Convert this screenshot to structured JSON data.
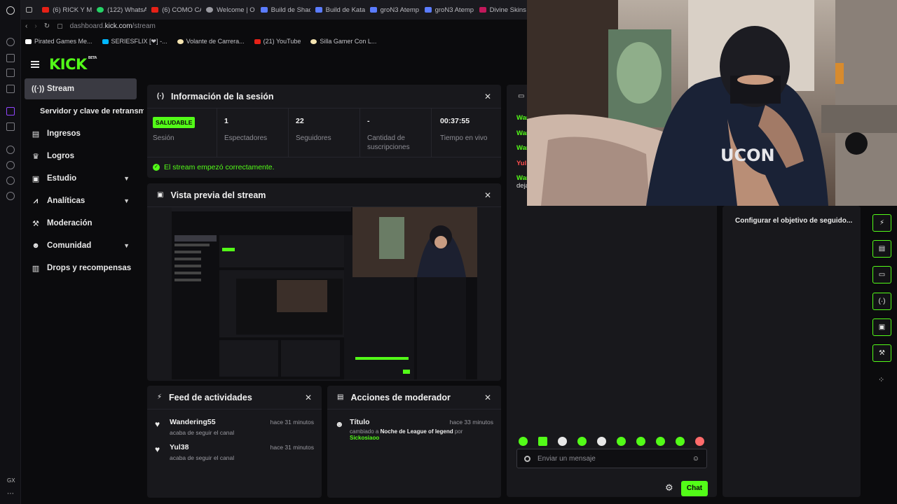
{
  "browser": {
    "tabs": [
      {
        "label": "(6) RICK Y M",
        "color": "#e62117"
      },
      {
        "label": "(122) WhatsA",
        "color": "#25d366"
      },
      {
        "label": "(6) COMO CA",
        "color": "#e62117"
      },
      {
        "label": "Welcome | O",
        "color": "#9a9aa1"
      },
      {
        "label": "Build de Shac",
        "color": "#5b7cff"
      },
      {
        "label": "Build de Kata",
        "color": "#5b7cff"
      },
      {
        "label": "groN3 Atemp",
        "color": "#5b7cff"
      },
      {
        "label": "groN3 Atemp",
        "color": "#5b7cff"
      },
      {
        "label": "Divine Skins",
        "color": "#c2185b"
      }
    ],
    "url_prefix": "dashboard.",
    "url_domain": "kick.com",
    "url_path": "/stream",
    "bookmarks": [
      {
        "label": "Pirated Games Me...",
        "color": "#ffffff"
      },
      {
        "label": "SERIESFLIX [❤] -...",
        "color": "#00b7ff"
      },
      {
        "label": "Volante de Carrera...",
        "color": "#f4e3b0"
      },
      {
        "label": "(21) YouTube",
        "color": "#e62117"
      },
      {
        "label": "Silla Gamer Con L...",
        "color": "#f4e3b0"
      }
    ],
    "gx_label": "GX"
  },
  "brand": {
    "logo": "KICK",
    "beta": "BETA",
    "accent": "#53fc18"
  },
  "sidebar": {
    "items": [
      {
        "label": "Stream",
        "icon": "broadcast-icon"
      },
      {
        "label": "Servidor y clave de retransm"
      },
      {
        "label": "Ingresos",
        "icon": "wallet-icon"
      },
      {
        "label": "Logros",
        "icon": "trophy-icon"
      },
      {
        "label": "Estudio",
        "icon": "studio-icon"
      },
      {
        "label": "Analíticas",
        "icon": "analytics-icon"
      },
      {
        "label": "Moderación",
        "icon": "wrench-icon"
      },
      {
        "label": "Comunidad",
        "icon": "community-icon"
      },
      {
        "label": "Drops y recompensas",
        "icon": "drops-icon"
      }
    ]
  },
  "session": {
    "title": "Información de la sesión",
    "status_badge": "SALUDABLE",
    "status_label": "Sesión",
    "viewers_value": "1",
    "viewers_label": "Espectadores",
    "followers_value": "22",
    "followers_label": "Seguidores",
    "subs_value": "-",
    "subs_label": "Cantidad de suscripciones",
    "time_value": "00:37:55",
    "time_label": "Tiempo en vivo",
    "message": "El stream empezó correctamente."
  },
  "preview": {
    "title": "Vista previa del stream"
  },
  "activity": {
    "title": "Feed de actividades",
    "items": [
      {
        "name": "Wandering55",
        "sub": "acaba de seguir el canal",
        "time": "hace 31 minutos"
      },
      {
        "name": "Yul38",
        "sub": "acaba de seguir el canal",
        "time": "hace 31 minutos"
      }
    ]
  },
  "mod_actions": {
    "title": "Acciones de moderador",
    "item": {
      "name": "Título",
      "time": "hace 33 minutos",
      "prefix": "cambiado a",
      "value": "Noche de League of legend",
      "by": "por",
      "user": "Sickosiaoo"
    }
  },
  "chat": {
    "lines": [
      "Wan",
      "Wan",
      "Wan",
      "Yul",
      "Wan",
      "deja"
    ],
    "input_placeholder": "Enviar un mensaje",
    "send_label": "Chat"
  },
  "settings": {
    "goal_label": "Configurar el objetivo de seguido..."
  }
}
